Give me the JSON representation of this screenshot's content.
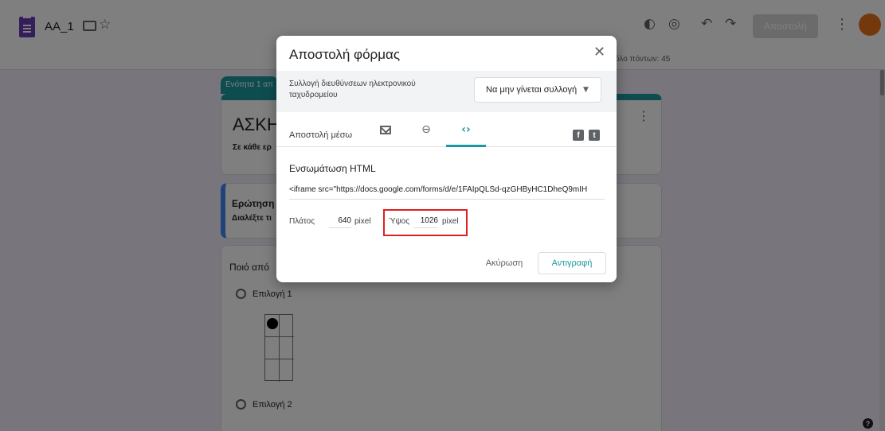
{
  "app": {
    "doc_title": "AA_1",
    "send_label": "Αποστολή",
    "points_text": "όλο πόντων: 45"
  },
  "form": {
    "section_tag": "Ενότητα 1 απ",
    "title": "ΑΣΚΗ",
    "title_desc": "Σε κάθε ερ",
    "question1_title": "Ερώτηση",
    "question1_desc": "Διαλέξτε τι",
    "question2_text": "Ποιό από",
    "option1": "Επιλογή 1",
    "option2": "Επιλογή 2"
  },
  "dialog": {
    "title": "Αποστολή φόρμας",
    "collect_label": "Συλλογή διευθύνσεων ηλεκτρονικού ταχυδρομείου",
    "collect_value": "Να μην γίνεται συλλογή",
    "send_via_label": "Αποστολή μέσω",
    "link_tab": "⊖",
    "embed_tab": "‹›",
    "embed_heading": "Ενσωμάτωση HTML",
    "embed_code": "<iframe src=\"https://docs.google.com/forms/d/e/1FAIpQLSd-qzGHByHC1DheQ9mIH",
    "width_label": "Πλάτος",
    "width_value": "640",
    "width_unit": "pixel",
    "height_label": "Ύψος",
    "height_value": "1026",
    "height_unit": "pixel",
    "cancel_label": "Ακύρωση",
    "copy_label": "Αντιγραφή"
  },
  "colors": {
    "accent": "#1a9aa0",
    "highlight": "#e02020",
    "form_icon": "#673ab7"
  }
}
